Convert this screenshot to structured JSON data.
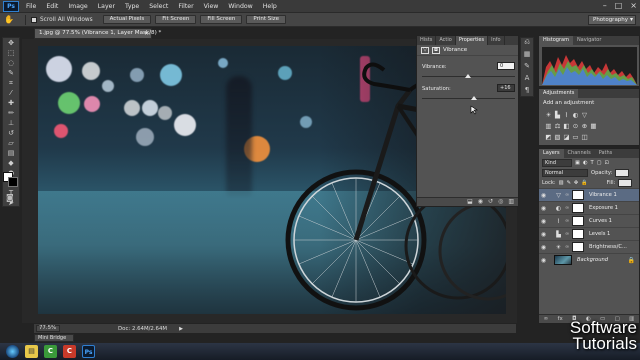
{
  "app": {
    "logo": "Ps",
    "menu": [
      "File",
      "Edit",
      "Image",
      "Layer",
      "Type",
      "Select",
      "Filter",
      "View",
      "Window",
      "Help"
    ],
    "window_controls": [
      "–",
      "□",
      "×"
    ]
  },
  "options_bar": {
    "tool_icon": "hand-icon",
    "scroll_all_windows": "Scroll All Windows",
    "buttons": [
      "Actual Pixels",
      "Fit Screen",
      "Fill Screen",
      "Print Size"
    ],
    "workspace": "Photography"
  },
  "document": {
    "tab_title": "1.jpg @ 77.5% (Vibrance 1, Layer Mask/8) *",
    "close": "×"
  },
  "properties_panel": {
    "tabs": [
      "Hists",
      "Actio",
      "Properties",
      "Info"
    ],
    "active_tab": "Properties",
    "header": "Vibrance",
    "vibrance_label": "Vibrance:",
    "vibrance_value": "0",
    "saturation_label": "Saturation:",
    "saturation_value": "+16"
  },
  "histogram_panel": {
    "tabs": [
      "Histogram",
      "Navigator"
    ],
    "active_tab": "Histogram"
  },
  "adjustments_panel": {
    "tab": "Adjustments",
    "title": "Add an adjustment"
  },
  "layers_panel": {
    "tabs": [
      "Layers",
      "Channels",
      "Paths"
    ],
    "active_tab": "Layers",
    "filter_label": "Kind",
    "blend_mode": "Normal",
    "opacity_label": "Opacity:",
    "opacity_value": "",
    "lock_label": "Lock:",
    "fill_label": "Fill:",
    "fill_value": "",
    "layers": [
      {
        "name": "Vibrance 1",
        "type": "adjustment",
        "selected": true
      },
      {
        "name": "Exposure 1",
        "type": "adjustment",
        "selected": false
      },
      {
        "name": "Curves 1",
        "type": "adjustment",
        "selected": false
      },
      {
        "name": "Levels 1",
        "type": "adjustment",
        "selected": false
      },
      {
        "name": "Brightness/C...",
        "type": "adjustment",
        "selected": false
      },
      {
        "name": "Background",
        "type": "image",
        "selected": false
      }
    ]
  },
  "status_bar": {
    "zoom": "77.5%",
    "doc_size": "Doc: 2.64M/2.64M",
    "arrow": "▶"
  },
  "mini_bridge": "Mini Bridge",
  "watermark": {
    "line1": "Software",
    "line2": "Tutorials"
  },
  "colors": {
    "accent_selection": "#5b6b83",
    "ps_blue": "#2f7fd0",
    "panel_bg": "#535353"
  }
}
